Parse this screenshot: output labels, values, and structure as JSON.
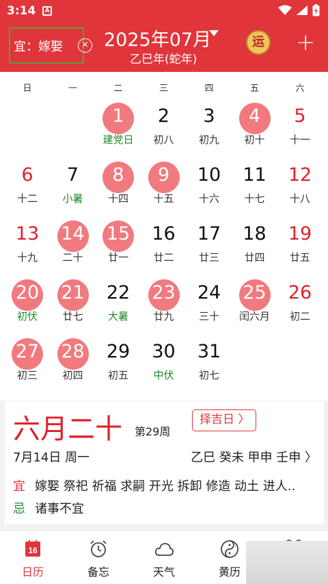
{
  "status": {
    "time": "3:14",
    "app_letter": "A"
  },
  "header": {
    "yi_label": "宜：嫁娶",
    "close_glyph": "×",
    "month_title": "2025年07月",
    "month_sub": "乙巳年(蛇年)",
    "fortune_glyph": "运",
    "plus_glyph": "+"
  },
  "calendar": {
    "weekdays": [
      "日",
      "一",
      "二",
      "三",
      "四",
      "五",
      "六"
    ],
    "days": [
      {
        "day": "1",
        "lunar": "建党日",
        "circle": true,
        "red": false,
        "lunar_green": true
      },
      {
        "day": "2",
        "lunar": "初八",
        "circle": false,
        "red": false,
        "lunar_green": false
      },
      {
        "day": "3",
        "lunar": "初九",
        "circle": false,
        "red": false,
        "lunar_green": false
      },
      {
        "day": "4",
        "lunar": "初十",
        "circle": true,
        "red": false,
        "lunar_green": false
      },
      {
        "day": "5",
        "lunar": "十一",
        "circle": false,
        "red": true,
        "lunar_green": false
      },
      {
        "day": "6",
        "lunar": "十二",
        "circle": false,
        "red": true,
        "lunar_green": false
      },
      {
        "day": "7",
        "lunar": "小暑",
        "circle": false,
        "red": false,
        "lunar_green": true
      },
      {
        "day": "8",
        "lunar": "十四",
        "circle": true,
        "red": false,
        "lunar_green": false
      },
      {
        "day": "9",
        "lunar": "十五",
        "circle": true,
        "red": false,
        "lunar_green": false
      },
      {
        "day": "10",
        "lunar": "十六",
        "circle": false,
        "red": false,
        "lunar_green": false
      },
      {
        "day": "11",
        "lunar": "十七",
        "circle": false,
        "red": false,
        "lunar_green": false
      },
      {
        "day": "12",
        "lunar": "十八",
        "circle": false,
        "red": true,
        "lunar_green": false
      },
      {
        "day": "13",
        "lunar": "十九",
        "circle": false,
        "red": true,
        "lunar_green": false
      },
      {
        "day": "14",
        "lunar": "二十",
        "circle": true,
        "red": false,
        "lunar_green": false
      },
      {
        "day": "15",
        "lunar": "廿一",
        "circle": true,
        "red": false,
        "lunar_green": false
      },
      {
        "day": "16",
        "lunar": "廿二",
        "circle": false,
        "red": false,
        "lunar_green": false
      },
      {
        "day": "17",
        "lunar": "廿三",
        "circle": false,
        "red": false,
        "lunar_green": false
      },
      {
        "day": "18",
        "lunar": "廿四",
        "circle": false,
        "red": false,
        "lunar_green": false
      },
      {
        "day": "19",
        "lunar": "廿五",
        "circle": false,
        "red": true,
        "lunar_green": false
      },
      {
        "day": "20",
        "lunar": "初伏",
        "circle": true,
        "red": false,
        "lunar_green": true
      },
      {
        "day": "21",
        "lunar": "廿七",
        "circle": true,
        "red": false,
        "lunar_green": false
      },
      {
        "day": "22",
        "lunar": "大暑",
        "circle": false,
        "red": false,
        "lunar_green": true
      },
      {
        "day": "23",
        "lunar": "廿九",
        "circle": true,
        "red": false,
        "lunar_green": false
      },
      {
        "day": "24",
        "lunar": "三十",
        "circle": false,
        "red": false,
        "lunar_green": false
      },
      {
        "day": "25",
        "lunar": "闰六月",
        "circle": true,
        "red": false,
        "lunar_green": false
      },
      {
        "day": "26",
        "lunar": "初二",
        "circle": false,
        "red": true,
        "lunar_green": false
      },
      {
        "day": "27",
        "lunar": "初三",
        "circle": true,
        "red": false,
        "lunar_green": false
      },
      {
        "day": "28",
        "lunar": "初四",
        "circle": true,
        "red": false,
        "lunar_green": false
      },
      {
        "day": "29",
        "lunar": "初五",
        "circle": false,
        "red": false,
        "lunar_green": false
      },
      {
        "day": "30",
        "lunar": "中伏",
        "circle": false,
        "red": false,
        "lunar_green": true
      },
      {
        "day": "31",
        "lunar": "初七",
        "circle": false,
        "red": false,
        "lunar_green": false
      }
    ]
  },
  "detail": {
    "lunar_date": "六月二十",
    "week_no": "第29周",
    "button_label": "择吉日 〉",
    "date": "7月14日 周一",
    "ganzhi": "乙巳  癸未  甲申  壬申  〉",
    "yi_label": "宜",
    "yi_items": "嫁娶 祭祀 祈福 求嗣 开光 拆卸 修造 动土 进人..",
    "ji_label": "忌",
    "ji_items": "诸事不宜"
  },
  "nav": {
    "items": [
      {
        "label": "日历",
        "icon": "calendar-icon",
        "active": true,
        "icon_text": "16"
      },
      {
        "label": "备忘",
        "icon": "alarm-clock-icon",
        "active": false
      },
      {
        "label": "天气",
        "icon": "cloud-icon",
        "active": false
      },
      {
        "label": "黄历",
        "icon": "yin-yang-icon",
        "active": false
      }
    ]
  },
  "colors": {
    "accent": "#e0353a",
    "circle": "#f17a7f",
    "green": "#1c8a2a"
  }
}
